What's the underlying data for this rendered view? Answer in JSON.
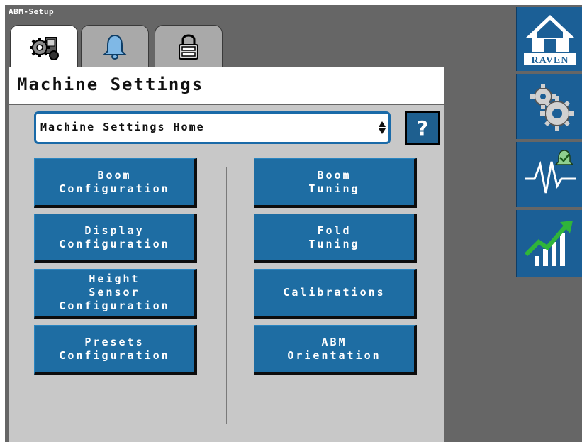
{
  "app": {
    "title": "ABM-Setup"
  },
  "tabs": [
    {
      "icon": "machine-icon",
      "active": true
    },
    {
      "icon": "bell-icon",
      "active": false
    },
    {
      "icon": "lock-icon",
      "active": false
    }
  ],
  "page": {
    "title": "Machine Settings"
  },
  "dropdown": {
    "value": "Machine Settings Home"
  },
  "help": {
    "label": "?"
  },
  "buttons": {
    "left": [
      "Boom\nConfiguration",
      "Display\nConfiguration",
      "Height\nSensor\nConfiguration",
      "Presets\nConfiguration"
    ],
    "right": [
      "Boom\nTuning",
      "Fold\nTuning",
      "Calibrations",
      "ABM\nOrientation"
    ]
  },
  "sidebar": {
    "home": {
      "brand": "RAVEN",
      "icon": "home-icon"
    },
    "items": [
      {
        "icon": "gears-icon"
      },
      {
        "icon": "diagnostics-alert-icon"
      },
      {
        "icon": "performance-chart-icon"
      }
    ]
  },
  "colors": {
    "button_blue": "#1e6da3",
    "sidebar_blue": "#1b5f96",
    "dropdown_border": "#1a6aa8",
    "frame_gray": "#666666",
    "panel_gray": "#c8c8c8",
    "check_green": "#2fb53a"
  }
}
